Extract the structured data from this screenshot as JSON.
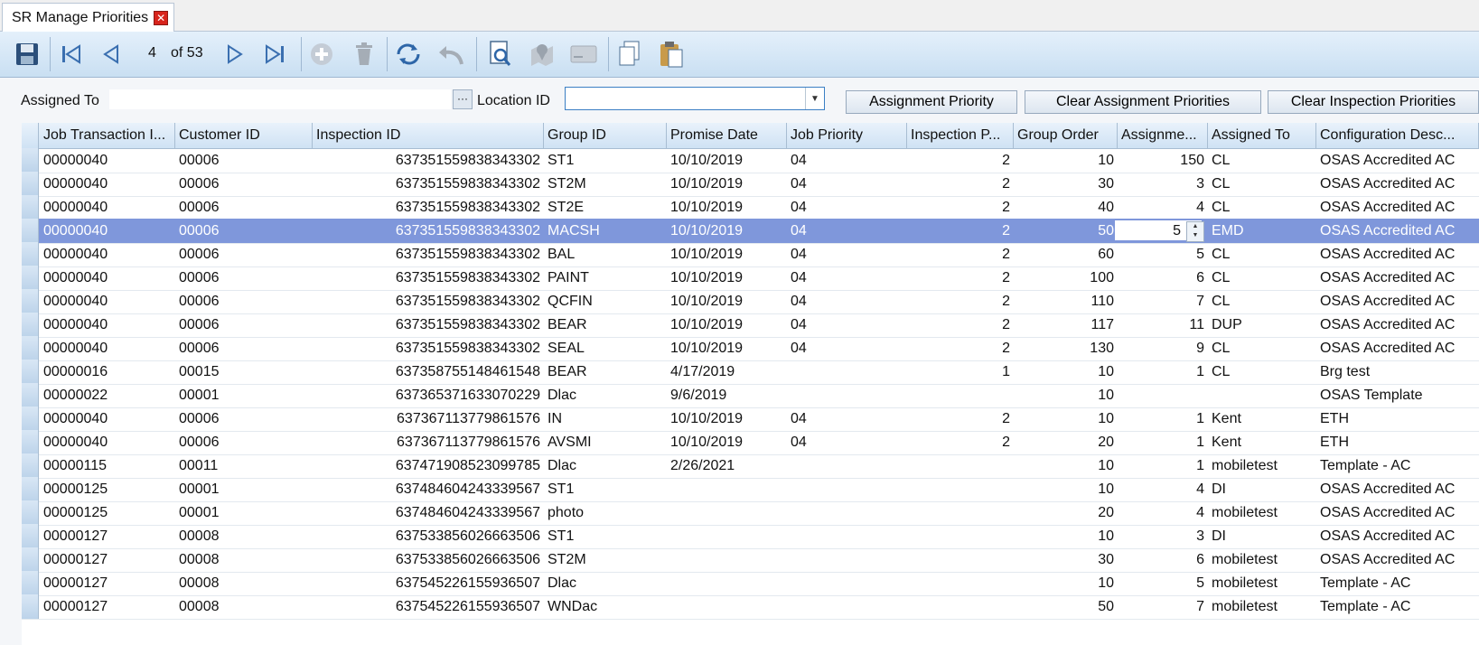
{
  "tab": {
    "title": "SR Manage Priorities"
  },
  "toolbar": {
    "pager": {
      "current": "4",
      "of_label": "of 53"
    }
  },
  "filter": {
    "assigned_to_label": "Assigned To",
    "assigned_to_value": "",
    "location_label": "Location ID",
    "location_value": "",
    "btn_assignment_priority": "Assignment Priority",
    "btn_clear_assignment": "Clear Assignment Priorities",
    "btn_clear_inspection": "Clear Inspection Priorities"
  },
  "grid": {
    "columns": [
      "Job Transaction I...",
      "Customer ID",
      "Inspection ID",
      "Group ID",
      "Promise Date",
      "Job Priority",
      "Inspection P...",
      "Group Order",
      "Assignme...",
      "Assigned To",
      "Configuration Desc..."
    ],
    "rows": [
      [
        "00000040",
        "00006",
        "637351559838343302",
        "ST1",
        "10/10/2019",
        "04",
        "2",
        "10",
        "150",
        "CL",
        "OSAS Accredited AC"
      ],
      [
        "00000040",
        "00006",
        "637351559838343302",
        "ST2M",
        "10/10/2019",
        "04",
        "2",
        "30",
        "3",
        "CL",
        "OSAS Accredited AC"
      ],
      [
        "00000040",
        "00006",
        "637351559838343302",
        "ST2E",
        "10/10/2019",
        "04",
        "2",
        "40",
        "4",
        "CL",
        "OSAS Accredited AC"
      ],
      [
        "00000040",
        "00006",
        "637351559838343302",
        "MACSH",
        "10/10/2019",
        "04",
        "2",
        "50",
        "5",
        "EMD",
        "OSAS Accredited AC"
      ],
      [
        "00000040",
        "00006",
        "637351559838343302",
        "BAL",
        "10/10/2019",
        "04",
        "2",
        "60",
        "5",
        "CL",
        "OSAS Accredited AC"
      ],
      [
        "00000040",
        "00006",
        "637351559838343302",
        "PAINT",
        "10/10/2019",
        "04",
        "2",
        "100",
        "6",
        "CL",
        "OSAS Accredited AC"
      ],
      [
        "00000040",
        "00006",
        "637351559838343302",
        "QCFIN",
        "10/10/2019",
        "04",
        "2",
        "110",
        "7",
        "CL",
        "OSAS Accredited AC"
      ],
      [
        "00000040",
        "00006",
        "637351559838343302",
        "BEAR",
        "10/10/2019",
        "04",
        "2",
        "117",
        "11",
        "DUP",
        "OSAS Accredited AC"
      ],
      [
        "00000040",
        "00006",
        "637351559838343302",
        "SEAL",
        "10/10/2019",
        "04",
        "2",
        "130",
        "9",
        "CL",
        "OSAS Accredited AC"
      ],
      [
        "00000016",
        "00015",
        "637358755148461548",
        "BEAR",
        "4/17/2019",
        "",
        "1",
        "10",
        "1",
        "CL",
        "Brg test"
      ],
      [
        "00000022",
        "00001",
        "637365371633070229",
        "Dlac",
        "9/6/2019",
        "",
        "",
        "10",
        "",
        "",
        "OSAS Template"
      ],
      [
        "00000040",
        "00006",
        "637367113779861576",
        "IN",
        "10/10/2019",
        "04",
        "2",
        "10",
        "1",
        "Kent",
        "ETH"
      ],
      [
        "00000040",
        "00006",
        "637367113779861576",
        "AVSMI",
        "10/10/2019",
        "04",
        "2",
        "20",
        "1",
        "Kent",
        "ETH"
      ],
      [
        "00000115",
        "00011",
        "637471908523099785",
        "Dlac",
        "2/26/2021",
        "",
        "",
        "10",
        "1",
        "mobiletest",
        "Template - AC"
      ],
      [
        "00000125",
        "00001",
        "637484604243339567",
        "ST1",
        "",
        "",
        "",
        "10",
        "4",
        "DI",
        "OSAS Accredited AC"
      ],
      [
        "00000125",
        "00001",
        "637484604243339567",
        "photo",
        "",
        "",
        "",
        "20",
        "4",
        "mobiletest",
        "OSAS Accredited AC"
      ],
      [
        "00000127",
        "00008",
        "637533856026663506",
        "ST1",
        "",
        "",
        "",
        "10",
        "3",
        "DI",
        "OSAS Accredited AC"
      ],
      [
        "00000127",
        "00008",
        "637533856026663506",
        "ST2M",
        "",
        "",
        "",
        "30",
        "6",
        "mobiletest",
        "OSAS Accredited AC"
      ],
      [
        "00000127",
        "00008",
        "637545226155936507",
        "Dlac",
        "",
        "",
        "",
        "10",
        "5",
        "mobiletest",
        "Template - AC"
      ],
      [
        "00000127",
        "00008",
        "637545226155936507",
        "WNDac",
        "",
        "",
        "",
        "50",
        "7",
        "mobiletest",
        "Template - AC"
      ]
    ],
    "selected_row": 3
  },
  "icons": [
    "save-icon",
    "first-icon",
    "prev-icon",
    "next-icon",
    "last-icon",
    "add-icon",
    "delete-icon",
    "refresh-icon",
    "undo-icon",
    "search-doc-icon",
    "map-pin-icon",
    "card-icon",
    "copy-icon",
    "paste-icon"
  ],
  "colors": {
    "selection": "#7f97db",
    "toolbar": "#c9dff2",
    "accent": "#3b7fc4"
  }
}
